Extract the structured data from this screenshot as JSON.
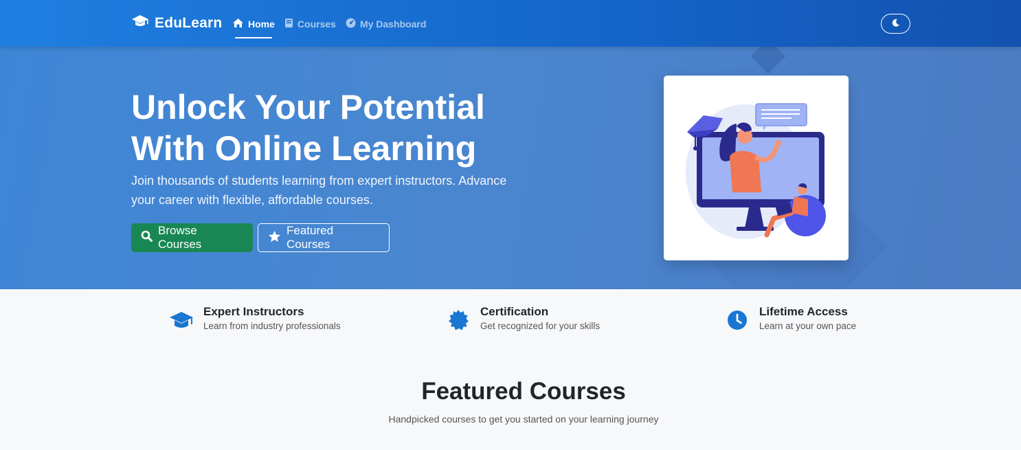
{
  "nav": {
    "brand": "EduLearn",
    "links": [
      {
        "label": "Home",
        "icon": "home-icon",
        "active": true
      },
      {
        "label": "Courses",
        "icon": "book-icon",
        "active": false
      },
      {
        "label": "My Dashboard",
        "icon": "dashboard-icon",
        "active": false
      }
    ],
    "theme_toggle_icon": "moon-icon"
  },
  "hero": {
    "title_line1": "Unlock Your Potential",
    "title_line2": "With Online Learning",
    "subtitle": "Join thousands of students learning from expert instructors. Advance your career with flexible, affordable courses.",
    "browse_label": "Browse Courses",
    "featured_label": "Featured Courses",
    "illustration": "online-learning-illustration"
  },
  "features": [
    {
      "title": "Expert Instructors",
      "desc": "Learn from industry professionals",
      "icon": "graduation-cap-icon"
    },
    {
      "title": "Certification",
      "desc": "Get recognized for your skills",
      "icon": "certificate-icon"
    },
    {
      "title": "Lifetime Access",
      "desc": "Learn at your own pace",
      "icon": "clock-icon"
    }
  ],
  "section": {
    "title": "Featured Courses",
    "subtitle": "Handpicked courses to get you started on your learning journey"
  },
  "colors": {
    "nav_bg": "#1565c9",
    "hero_bg": "#4a86cf",
    "success": "#198754",
    "icon_blue": "#1976d2"
  }
}
